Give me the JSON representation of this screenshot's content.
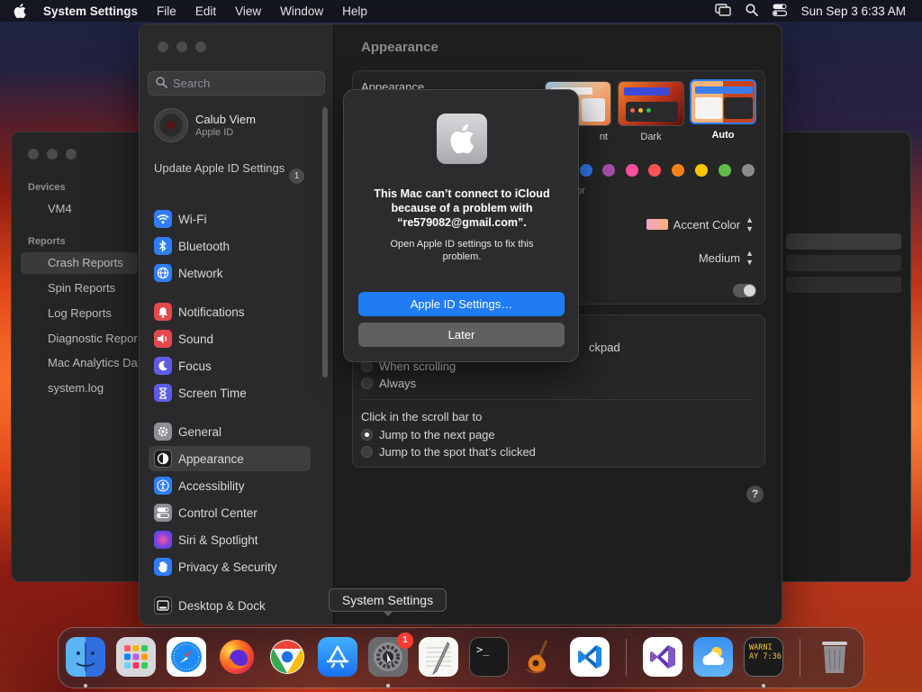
{
  "menubar": {
    "app_name": "System Settings",
    "menus": [
      "File",
      "Edit",
      "View",
      "Window",
      "Help"
    ],
    "clock": "Sun Sep 3  6:33 AM",
    "status_icons": [
      "screen-mirroring-icon",
      "search-icon",
      "control-center-icon"
    ]
  },
  "background_window": {
    "devices_section": "Devices",
    "device": "VM4",
    "reports_section": "Reports",
    "items": [
      "Crash Reports",
      "Spin Reports",
      "Log Reports",
      "Diagnostic Reports",
      "Mac Analytics Data",
      "system.log"
    ],
    "selected": "Crash Reports"
  },
  "sidebar": {
    "search_placeholder": "Search",
    "user": {
      "name": "Calub Viem",
      "subtitle": "Apple ID"
    },
    "update": {
      "label": "Update Apple ID Settings",
      "badge": "1"
    },
    "items": [
      {
        "label": "Wi-Fi",
        "icon": "wifi-icon",
        "color": "#2f7cf6"
      },
      {
        "label": "Bluetooth",
        "icon": "bluetooth-icon",
        "color": "#2f7cf6"
      },
      {
        "label": "Network",
        "icon": "globe-icon",
        "color": "#2f7cf6"
      },
      {
        "label": "Notifications",
        "icon": "bell-icon",
        "color": "#e5484d"
      },
      {
        "label": "Sound",
        "icon": "speaker-icon",
        "color": "#e5484d"
      },
      {
        "label": "Focus",
        "icon": "moon-icon",
        "color": "#5e5ce6"
      },
      {
        "label": "Screen Time",
        "icon": "hourglass-icon",
        "color": "#5e5ce6"
      },
      {
        "label": "General",
        "icon": "gear-icon",
        "color": "#8e8e93"
      },
      {
        "label": "Appearance",
        "icon": "appearance-icon",
        "color": "#1c1c1e"
      },
      {
        "label": "Accessibility",
        "icon": "accessibility-icon",
        "color": "#2f7cf6"
      },
      {
        "label": "Control Center",
        "icon": "control-center-icon",
        "color": "#8e8e93"
      },
      {
        "label": "Siri & Spotlight",
        "icon": "siri-icon",
        "color": "#c04fd6"
      },
      {
        "label": "Privacy & Security",
        "icon": "hand-icon",
        "color": "#2f7cf6"
      },
      {
        "label": "Desktop & Dock",
        "icon": "dock-icon",
        "color": "#1c1c1e"
      }
    ],
    "selected": "Appearance"
  },
  "content": {
    "title": "Appearance",
    "appearance_label": "Appearance",
    "themes": [
      {
        "label": "Light",
        "visible_label": "nt"
      },
      {
        "label": "Dark",
        "visible_label": "Dark"
      },
      {
        "label": "Auto",
        "visible_label": "Auto"
      }
    ],
    "selected_theme": "Auto",
    "accent_colors": [
      "#2f7cf6",
      "#a550a7",
      "#f74f9e",
      "#ff5257",
      "#f7821b",
      "#ffc600",
      "#62ba46",
      "#8c8c8c"
    ],
    "accent_caption_fragment": "or",
    "highlight": {
      "value": "Accent Color"
    },
    "sidebar_icon_size": {
      "value": "Medium"
    },
    "wallpaper_tinting_enabled": true,
    "show_scroll_bars_fragment": "ckpad",
    "scroll_options": [
      "When scrolling",
      "Always"
    ],
    "click_scroll_bar_label": "Click in the scroll bar to",
    "click_options": [
      "Jump to the next page",
      "Jump to the spot that’s clicked"
    ],
    "click_selected": "Jump to the next page",
    "help": "?"
  },
  "alert": {
    "message": "This Mac can’t connect to iCloud because of a problem with “re579082@gmail.com”.",
    "informative": "Open Apple ID settings to fix this problem.",
    "primary_button": "Apple ID Settings…",
    "secondary_button": "Later"
  },
  "tooltip": {
    "text": "System Settings"
  },
  "dock": {
    "apps": [
      {
        "name": "Finder",
        "icon": "finder-icon",
        "running": true
      },
      {
        "name": "Launchpad",
        "icon": "launchpad-icon",
        "running": false
      },
      {
        "name": "Safari",
        "icon": "safari-icon",
        "running": false
      },
      {
        "name": "Firefox",
        "icon": "firefox-icon",
        "running": false
      },
      {
        "name": "Chrome",
        "icon": "chrome-icon",
        "running": false
      },
      {
        "name": "App Store",
        "icon": "app-store-icon",
        "running": false
      },
      {
        "name": "System Settings",
        "icon": "system-settings-icon",
        "running": true,
        "badge": "1"
      },
      {
        "name": "TextEdit",
        "icon": "textedit-icon",
        "running": false
      },
      {
        "name": "Terminal",
        "icon": "terminal-icon",
        "running": false
      },
      {
        "name": "GarageBand",
        "icon": "garageband-icon",
        "running": false
      },
      {
        "name": "VS Code",
        "icon": "vscode-icon",
        "running": false
      },
      {
        "name": "Visual Studio",
        "icon": "visual-studio-icon",
        "running": false
      },
      {
        "name": "Weather",
        "icon": "weather-icon",
        "running": false
      },
      {
        "name": "Console",
        "icon": "console-icon",
        "running": true,
        "label_lines": [
          "WARNI",
          "AY 7:36"
        ]
      },
      {
        "name": "Trash",
        "icon": "trash-icon",
        "running": false
      }
    ]
  }
}
